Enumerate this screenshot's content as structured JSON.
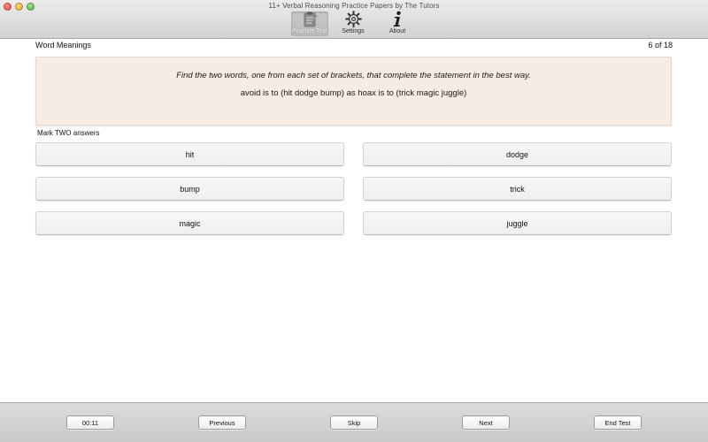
{
  "window": {
    "title": "11+ Verbal Reasoning Practice Papers by The Tutors"
  },
  "toolbar": {
    "items": [
      {
        "label": "Practice Test",
        "icon": "clipboard-icon",
        "selected": true
      },
      {
        "label": "Settings",
        "icon": "gear-icon",
        "selected": false
      },
      {
        "label": "About",
        "icon": "info-icon",
        "selected": false
      }
    ]
  },
  "header": {
    "section_title": "Word Meanings",
    "progress": "6 of 18"
  },
  "question": {
    "instruction": "Find the two words, one from each set of brackets, that complete the statement in the best way.",
    "statement": "avoid is to (hit dodge bump) as hoax is to (trick magic juggle)"
  },
  "answers": {
    "prompt": "Mark TWO answers",
    "options": [
      "hit",
      "dodge",
      "bump",
      "trick",
      "magic",
      "juggle"
    ]
  },
  "footer": {
    "timer": "00:11",
    "previous_label": "Previous",
    "skip_label": "Skip",
    "next_label": "Next",
    "end_label": "End Test"
  },
  "colors": {
    "card_background": "#f5ece4",
    "window_chrome": "#d6d6d6"
  }
}
